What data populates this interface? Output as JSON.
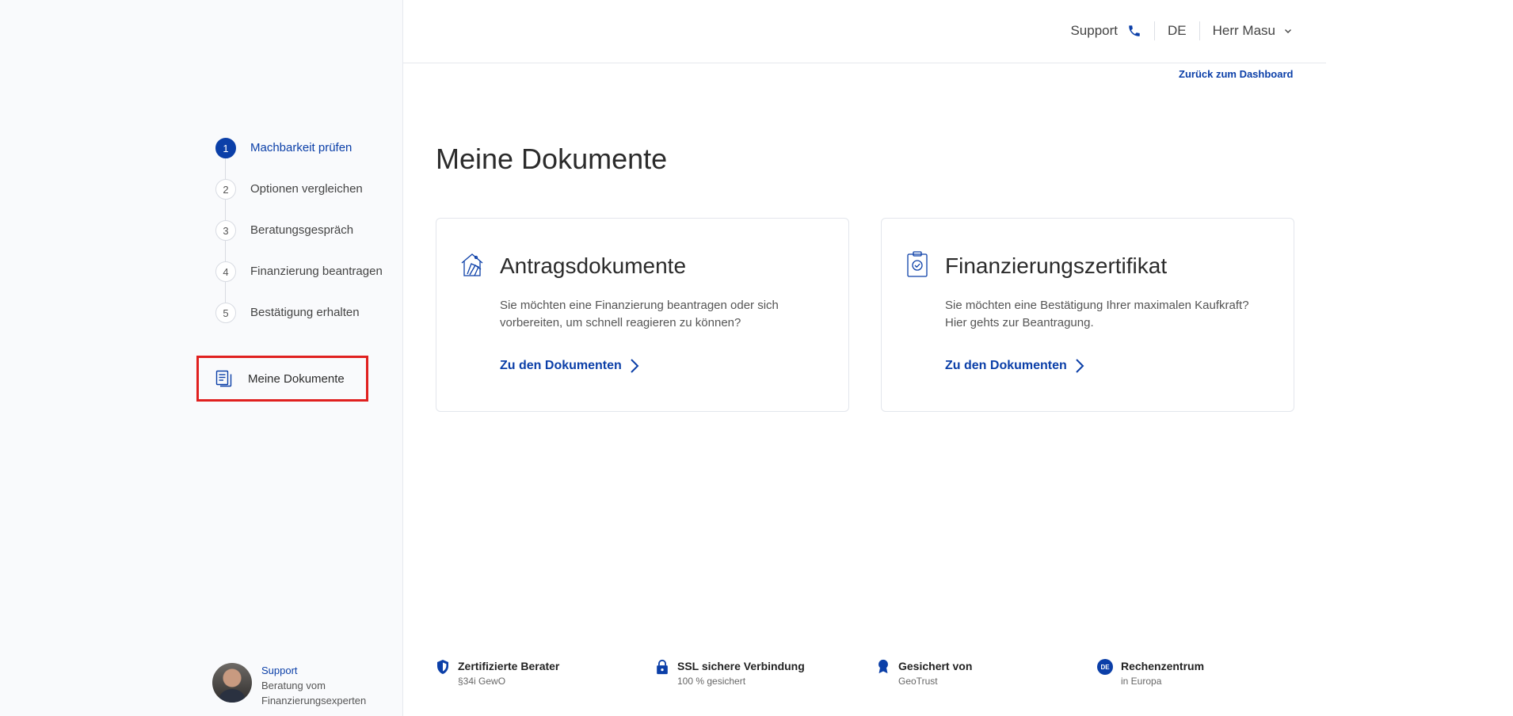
{
  "header": {
    "support_label": "Support",
    "language": "DE",
    "user_name": "Herr Masu",
    "back_link": "Zurück zum Dashboard"
  },
  "steps": [
    {
      "num": "1",
      "label": "Machbarkeit prüfen",
      "active": true
    },
    {
      "num": "2",
      "label": "Optionen vergleichen",
      "active": false
    },
    {
      "num": "3",
      "label": "Beratungsgespräch",
      "active": false
    },
    {
      "num": "4",
      "label": "Finanzierung beantragen",
      "active": false
    },
    {
      "num": "5",
      "label": "Bestätigung erhalten",
      "active": false
    }
  ],
  "sidebar": {
    "my_documents": "Meine Dokumente",
    "support_title": "Support",
    "support_line1": "Beratung vom",
    "support_line2": "Finanzierungsexperten"
  },
  "main": {
    "title": "Meine Dokumente",
    "cards": [
      {
        "title": "Antragsdokumente",
        "text": "Sie möchten eine Finanzierung beantragen oder sich vorbereiten, um schnell reagieren zu können?",
        "link": "Zu den Dokumenten"
      },
      {
        "title": "Finanzierungszertifikat",
        "text": "Sie möchten eine Bestätigung Ihrer maximalen Kaufkraft? Hier gehts zur Beantragung.",
        "link": "Zu den Dokumenten"
      }
    ]
  },
  "footer": [
    {
      "title": "Zertifizierte Berater",
      "sub": "§34i GewO",
      "icon": "shield-icon"
    },
    {
      "title": "SSL sichere Verbindung",
      "sub": "100 % gesichert",
      "icon": "lock-icon"
    },
    {
      "title": "Gesichert von",
      "sub": "GeoTrust",
      "icon": "award-icon"
    },
    {
      "title": "Rechenzentrum",
      "sub": "in Europa",
      "icon": "de-badge-icon",
      "badge": "DE"
    }
  ],
  "colors": {
    "accent": "#0b3fa8",
    "highlight": "#e0201f"
  }
}
